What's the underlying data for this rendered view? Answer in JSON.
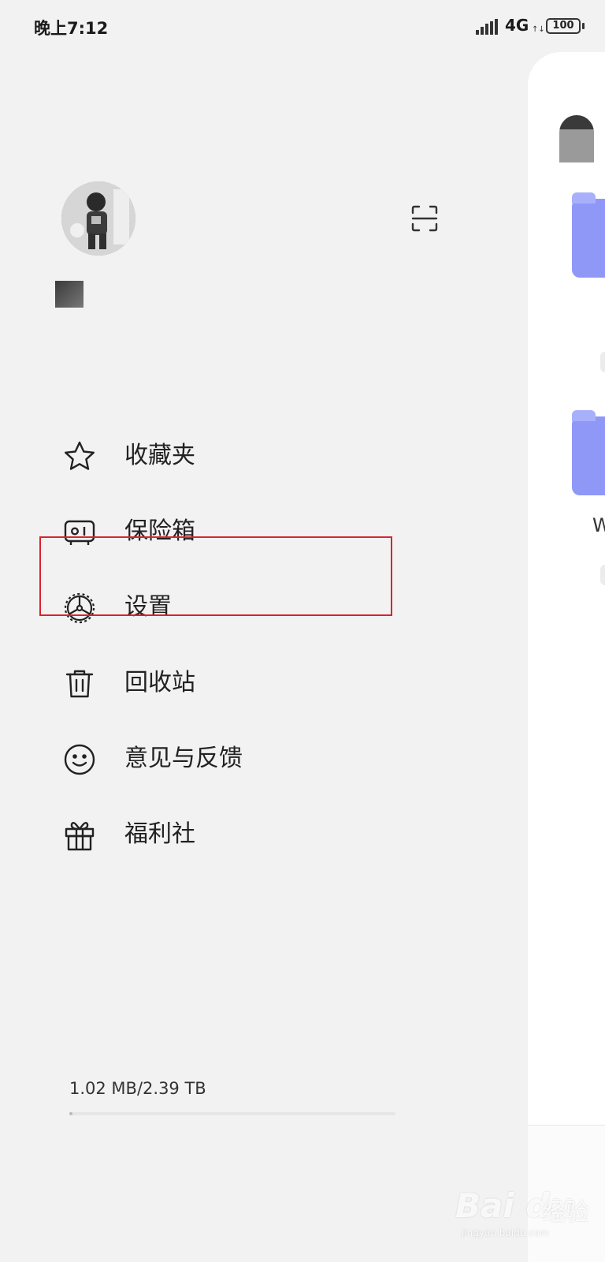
{
  "status_bar": {
    "time": "晚上7:12",
    "network": "4G",
    "battery": "100"
  },
  "drawer": {
    "icons": {
      "scan": "scan-icon",
      "avatar": "user-avatar"
    },
    "menu": [
      {
        "label": "收藏夹",
        "icon": "star-icon"
      },
      {
        "label": "保险箱",
        "icon": "safe-box-icon"
      },
      {
        "label": "设置",
        "icon": "settings-icon"
      },
      {
        "label": "回收站",
        "icon": "trash-icon"
      },
      {
        "label": "意见与反馈",
        "icon": "smiley-icon"
      },
      {
        "label": "福利社",
        "icon": "gift-icon"
      }
    ],
    "highlighted_item": "设置",
    "storage": {
      "text": "1.02 MB/2.39 TB",
      "used_fraction": 4e-07
    }
  },
  "main_peek": {
    "folder_caption": "W"
  },
  "watermark": {
    "logo": "Bai du",
    "text": "经验",
    "url": "jingyan.baidu.com"
  },
  "colors": {
    "highlight_border": "#d9232e",
    "folder": "#8f98f7",
    "drawer_bg": "#f2f2f2"
  }
}
